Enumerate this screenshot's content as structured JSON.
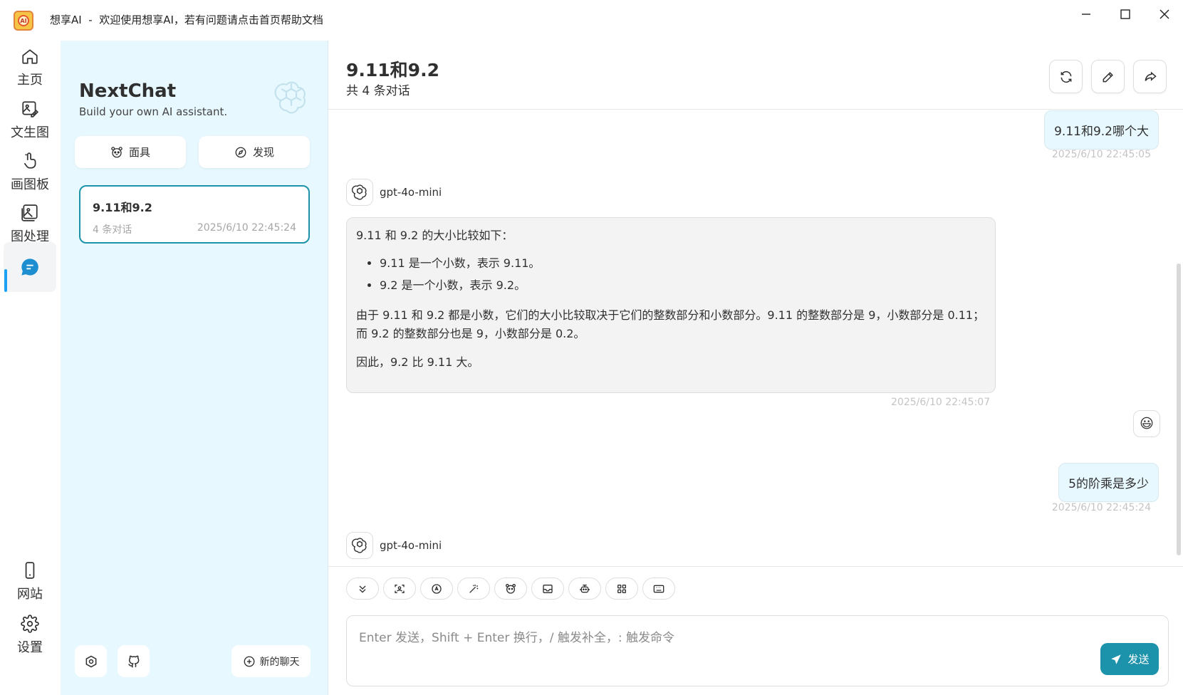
{
  "titlebar": {
    "app_name": "想享AI",
    "separator": "-",
    "message": "欢迎使用想享AI，若有问题请点击首页帮助文档"
  },
  "rail": {
    "items": [
      {
        "label": "主页",
        "icon": "home-icon"
      },
      {
        "label": "文生图",
        "icon": "image-edit-icon"
      },
      {
        "label": "画图板",
        "icon": "touch-draw-icon"
      },
      {
        "label": "图处理",
        "icon": "image-icon"
      },
      {
        "label": "",
        "icon": "chat-icon",
        "active": true
      }
    ],
    "bottom": [
      {
        "label": "网站",
        "icon": "phone-icon"
      },
      {
        "label": "设置",
        "icon": "gear-icon"
      }
    ]
  },
  "sidebar": {
    "title": "NextChat",
    "subtitle": "Build your own AI assistant.",
    "mask_button": "面具",
    "discover_button": "发现",
    "sessions": [
      {
        "title": "9.11和9.2",
        "count": "4 条对话",
        "date": "2025/6/10 22:45:24"
      }
    ],
    "new_chat": "新的聊天"
  },
  "chat": {
    "title": "9.11和9.2",
    "subtitle": "共 4 条对话",
    "messages": {
      "user1": {
        "text": "9.11和9.2哪个大",
        "time": "2025/6/10 22:45:05"
      },
      "bot1": {
        "model": "gpt-4o-mini",
        "intro": "9.11 和 9.2 的大小比较如下：",
        "bullet1": "9.11 是一个小数，表示 9.11。",
        "bullet2": "9.2 是一个小数，表示 9.2。",
        "para": "由于 9.11 和 9.2 都是小数，它们的大小比较取决于它们的整数部分和小数部分。9.11 的整数部分是 9，小数部分是 0.11；而 9.2 的整数部分也是 9，小数部分是 0.2。",
        "conclusion": "因此，9.2 比 9.11 大。",
        "time": "2025/6/10 22:45:07"
      },
      "emoji": "😃",
      "user2": {
        "text": "5的阶乘是多少",
        "time": "2025/6/10 22:45:24"
      },
      "bot2": {
        "model": "gpt-4o-mini"
      }
    }
  },
  "composer": {
    "placeholder": "Enter 发送，Shift + Enter 换行，/ 触发补全，: 触发命令",
    "send": "发送"
  },
  "colors": {
    "accent": "#1d93ab",
    "sidebar_bg": "#e7f8ff",
    "user_bubble": "#e7f8ff",
    "bot_bubble": "#f3f3f3"
  }
}
